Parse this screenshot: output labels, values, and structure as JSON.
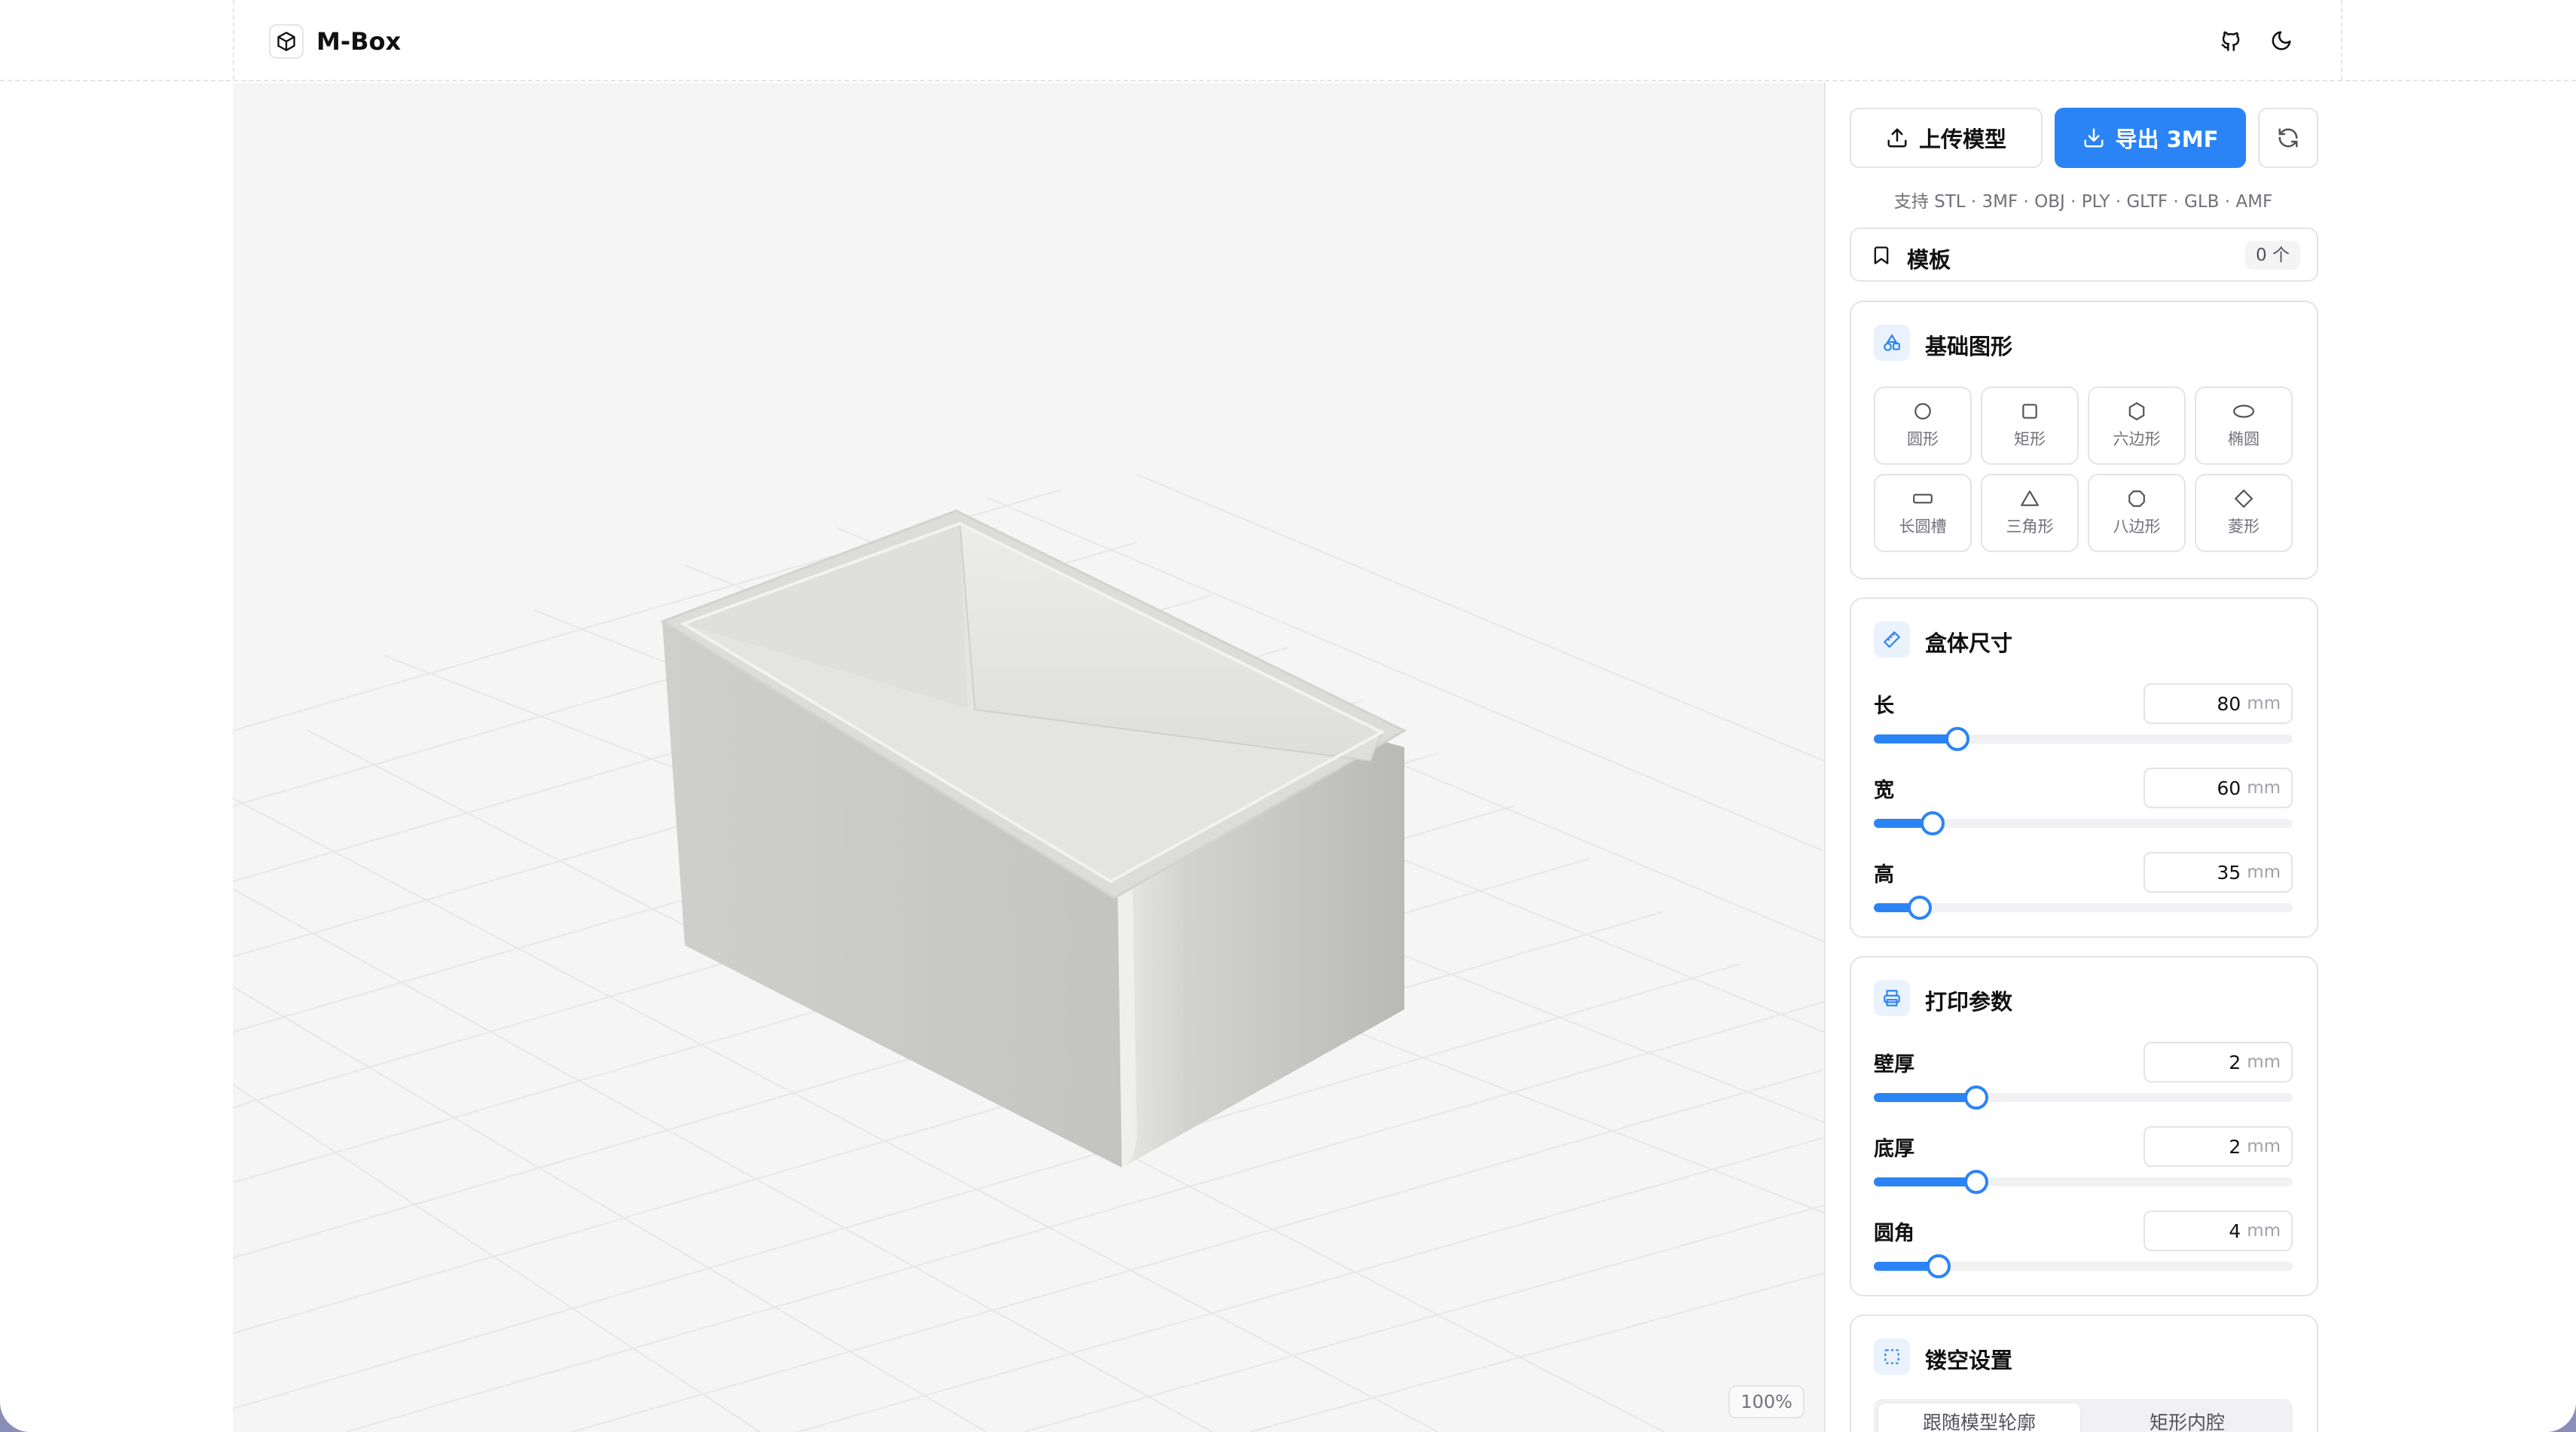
{
  "app": {
    "title": "M-Box"
  },
  "header": {
    "icons": [
      "box-logo-icon",
      "github-icon",
      "moon-icon"
    ]
  },
  "viewport": {
    "zoom": "100%"
  },
  "toolbar": {
    "upload_label": "上传模型",
    "export_label": "导出 3MF",
    "formats": "支持 STL · 3MF · OBJ · PLY · GLTF · GLB · AMF"
  },
  "templates": {
    "label": "模板",
    "count": "0 个"
  },
  "shapes": {
    "title": "基础图形",
    "items": [
      {
        "label": "圆形",
        "icon": "circle-icon"
      },
      {
        "label": "矩形",
        "icon": "square-icon"
      },
      {
        "label": "六边形",
        "icon": "hexagon-icon"
      },
      {
        "label": "椭圆",
        "icon": "ellipse-icon"
      },
      {
        "label": "长圆槽",
        "icon": "slot-icon"
      },
      {
        "label": "三角形",
        "icon": "triangle-icon"
      },
      {
        "label": "八边形",
        "icon": "octagon-icon"
      },
      {
        "label": "菱形",
        "icon": "diamond-icon"
      }
    ]
  },
  "dimensions": {
    "title": "盒体尺寸",
    "params": [
      {
        "label": "长",
        "value": "80",
        "unit": "mm",
        "fraction": 0.2
      },
      {
        "label": "宽",
        "value": "60",
        "unit": "mm",
        "fraction": 0.14
      },
      {
        "label": "高",
        "value": "35",
        "unit": "mm",
        "fraction": 0.11
      }
    ]
  },
  "print": {
    "title": "打印参数",
    "params": [
      {
        "label": "壁厚",
        "value": "2",
        "unit": "mm",
        "fraction": 0.245
      },
      {
        "label": "底厚",
        "value": "2",
        "unit": "mm",
        "fraction": 0.245
      },
      {
        "label": "圆角",
        "value": "4",
        "unit": "mm",
        "fraction": 0.155
      }
    ]
  },
  "hollow": {
    "title": "镂空设置",
    "tabs": [
      "跟随模型轮廓",
      "矩形内腔"
    ]
  },
  "colors": {
    "accent": "#2b84f5",
    "border": "#e4e4e7"
  }
}
